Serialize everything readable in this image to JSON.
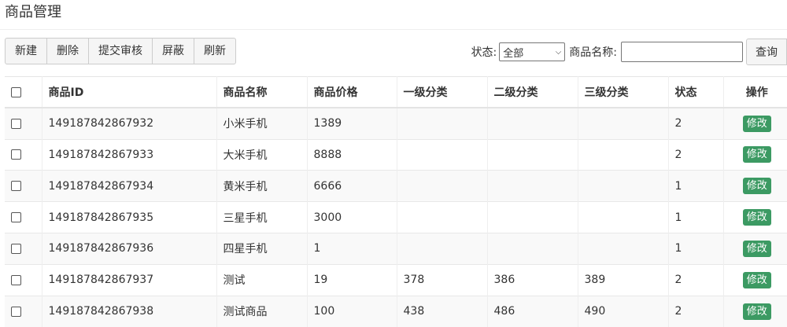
{
  "title": "商品管理",
  "toolbar": {
    "buttons": [
      "新建",
      "删除",
      "提交审核",
      "屏蔽",
      "刷新"
    ]
  },
  "filter": {
    "status_label": "状态:",
    "status_selected": "全部",
    "name_label": "商品名称:",
    "name_value": "",
    "query_label": "查询"
  },
  "table": {
    "headers": [
      "商品ID",
      "商品名称",
      "商品价格",
      "一级分类",
      "二级分类",
      "三级分类",
      "状态",
      "操作"
    ],
    "edit_label": "修改",
    "rows": [
      {
        "id": "149187842867932",
        "name": "小米手机",
        "price": "1389",
        "cat1": "",
        "cat2": "",
        "cat3": "",
        "status": "2"
      },
      {
        "id": "149187842867933",
        "name": "大米手机",
        "price": "8888",
        "cat1": "",
        "cat2": "",
        "cat3": "",
        "status": "2"
      },
      {
        "id": "149187842867934",
        "name": "黄米手机",
        "price": "6666",
        "cat1": "",
        "cat2": "",
        "cat3": "",
        "status": "1"
      },
      {
        "id": "149187842867935",
        "name": "三星手机",
        "price": "3000",
        "cat1": "",
        "cat2": "",
        "cat3": "",
        "status": "1"
      },
      {
        "id": "149187842867936",
        "name": "四星手机",
        "price": "1",
        "cat1": "",
        "cat2": "",
        "cat3": "",
        "status": "1"
      },
      {
        "id": "149187842867937",
        "name": "测试",
        "price": "19",
        "cat1": "378",
        "cat2": "386",
        "cat3": "389",
        "status": "2"
      },
      {
        "id": "149187842867938",
        "name": "测试商品",
        "price": "100",
        "cat1": "438",
        "cat2": "486",
        "cat3": "490",
        "status": "2"
      }
    ]
  }
}
